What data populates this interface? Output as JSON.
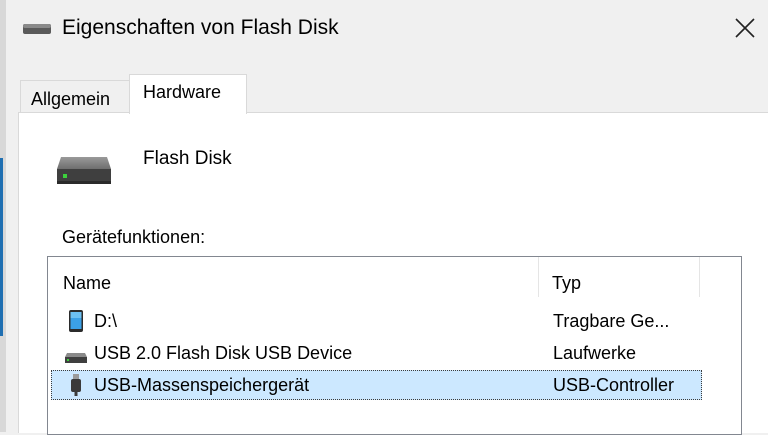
{
  "window": {
    "title": "Eigenschaften von Flash Disk"
  },
  "tabs": [
    {
      "label": "Allgemein"
    },
    {
      "label": "Hardware"
    }
  ],
  "device": {
    "name": "Flash Disk"
  },
  "functions": {
    "label": "Gerätefunktionen:",
    "columns": {
      "name": "Name",
      "type": "Typ"
    },
    "rows": [
      {
        "icon": "portable-device-icon",
        "name": "D:\\",
        "type": "Tragbare Ge..."
      },
      {
        "icon": "drive-icon",
        "name": "USB 2.0 Flash Disk USB Device",
        "type": "Laufwerke"
      },
      {
        "icon": "usb-plug-icon",
        "name": "USB-Massenspeichergerät",
        "type": "USB-Controller",
        "selected": true
      }
    ]
  },
  "colors": {
    "selection": "#cce8ff",
    "accent": "#1f6fb2"
  }
}
